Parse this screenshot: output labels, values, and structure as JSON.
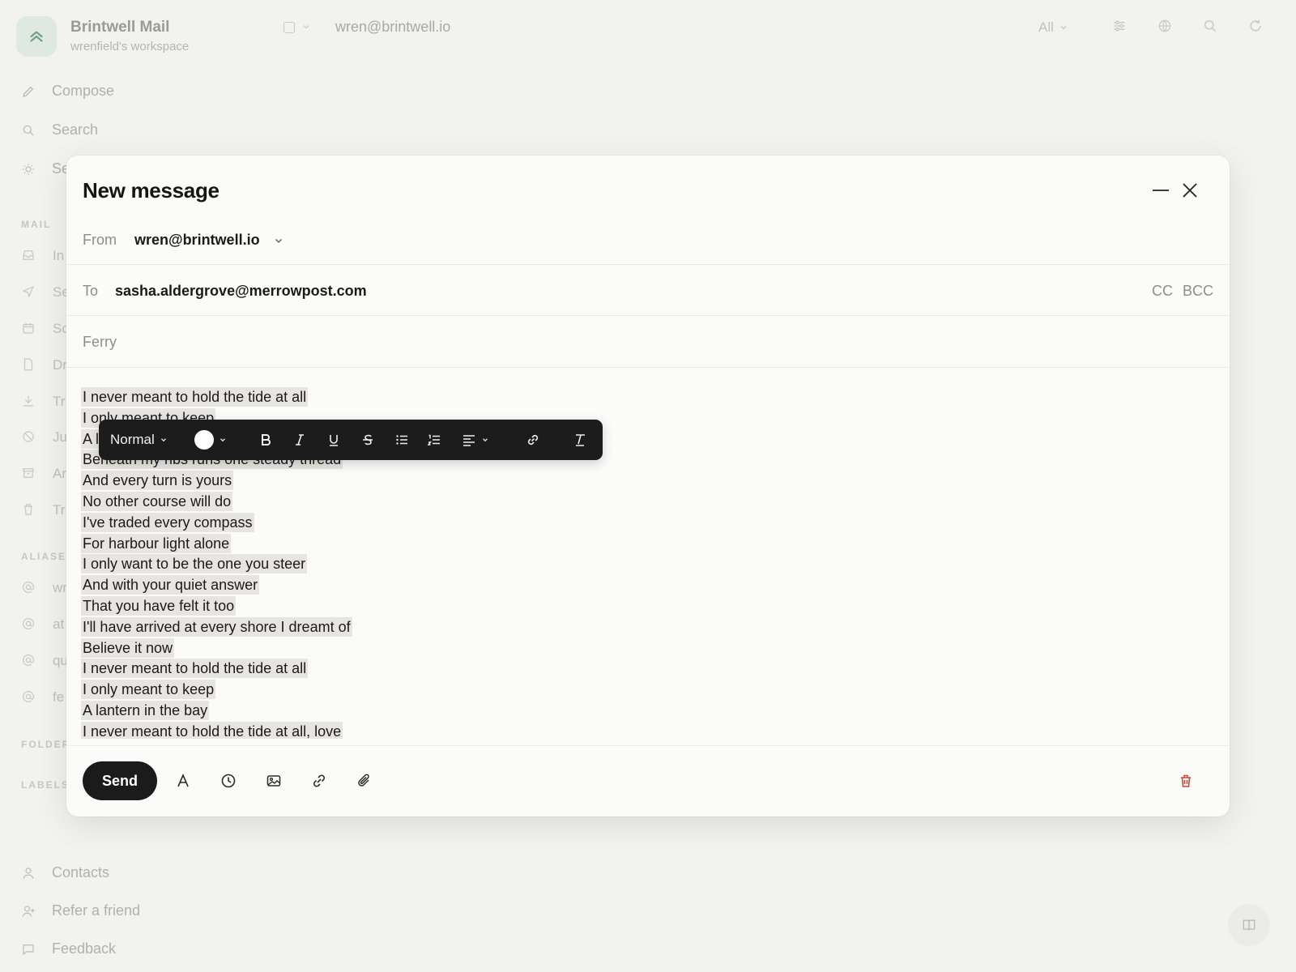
{
  "app": {
    "name": "Brintwell Mail",
    "workspace": "wrenfield's workspace",
    "current_account": "wren@brintwell.io",
    "filter_label": "All"
  },
  "sidebar": {
    "compose_label": "Compose",
    "search_label": "Search",
    "settings_fragment": "Se",
    "sections": {
      "mail": "MAIL",
      "aliases": "ALIASE",
      "folders": "FOLDER",
      "labels": "LABELS"
    },
    "mail_fragments": [
      "In",
      "Se",
      "Sc",
      "Dr",
      "Tr",
      "Ju",
      "Ar",
      "Tr"
    ],
    "alias_fragments": [
      "wr",
      "at",
      "qu",
      "fe"
    ],
    "bottom": {
      "contacts": "Contacts",
      "refer": "Refer a friend",
      "feedback": "Feedback"
    }
  },
  "compose": {
    "title": "New message",
    "from_label": "From",
    "from_value": "wren@brintwell.io",
    "to_label": "To",
    "to_value": "sasha.aldergrove@merrowpost.com",
    "cc_label": "CC",
    "bcc_label": "BCC",
    "subject": "Ferry",
    "body_lines": [
      "I never meant to hold the tide at all",
      "I only meant to keep",
      "A l",
      "Beneath my ribs runs one steady thread",
      "And every turn is yours",
      "No other course will do",
      "I've traded every compass",
      "For harbour light alone",
      "I only want to be the one you steer",
      "And with your quiet answer",
      "That you have felt it too",
      "I'll have arrived at every shore I dreamt of",
      "Believe it now",
      "I never meant to hold the tide at all",
      "I only meant to keep",
      "A lantern in the bay",
      "I never meant to hold the tide at all, love"
    ],
    "send_label": "Send"
  },
  "format_toolbar": {
    "style_label": "Normal",
    "color": "#ffffff"
  },
  "colors": {
    "accent_dark": "#1b1b1b",
    "danger": "#c94a3a"
  }
}
